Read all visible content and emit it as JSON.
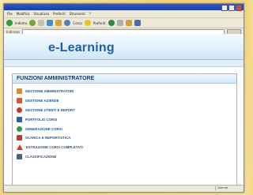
{
  "browser": {
    "menu": [
      "File",
      "Modifica",
      "Visualizza",
      "Preferiti",
      "Strumenti",
      "?"
    ],
    "toolbar": {
      "back_label": "Indietro",
      "search_label": "Cerca",
      "favorites_label": "Preferiti"
    },
    "address_label": "Indirizzo",
    "address_value": "",
    "go_label": "Vai",
    "status_text": "",
    "status_zone": "Internet"
  },
  "site": {
    "logo": "e-Learning",
    "nav_left": "",
    "nav_right": ""
  },
  "panel": {
    "title": "FUNZIONI AMMINISTRATORE",
    "items": [
      {
        "label": "GESTIONE AMMINISTRATORI",
        "icon": "admin-icon",
        "color": "#e08a2a"
      },
      {
        "label": "GESTIONE AZIENDE",
        "icon": "building-icon",
        "color": "#d35a2b"
      },
      {
        "label": "GESTIONE UTENTI E REPORT",
        "icon": "users-report-icon",
        "color": "#c0392b"
      },
      {
        "label": "PORTFOLIO CORSI",
        "icon": "portfolio-icon",
        "color": "#2e5fa8"
      },
      {
        "label": "GENERAZIONE CORSI",
        "icon": "generate-icon",
        "color": "#2f9a4a"
      },
      {
        "label": "SCARICA E REPORTISTICA",
        "icon": "download-icon",
        "color": "#c7372f"
      },
      {
        "label": "ESTRAZIONE CORSI COMPLETATI",
        "icon": "alert-icon",
        "color": "#d43a2a"
      },
      {
        "label": "CLASSIFICAZIONE",
        "icon": "classify-icon",
        "color": "#4a5f8a"
      }
    ]
  }
}
